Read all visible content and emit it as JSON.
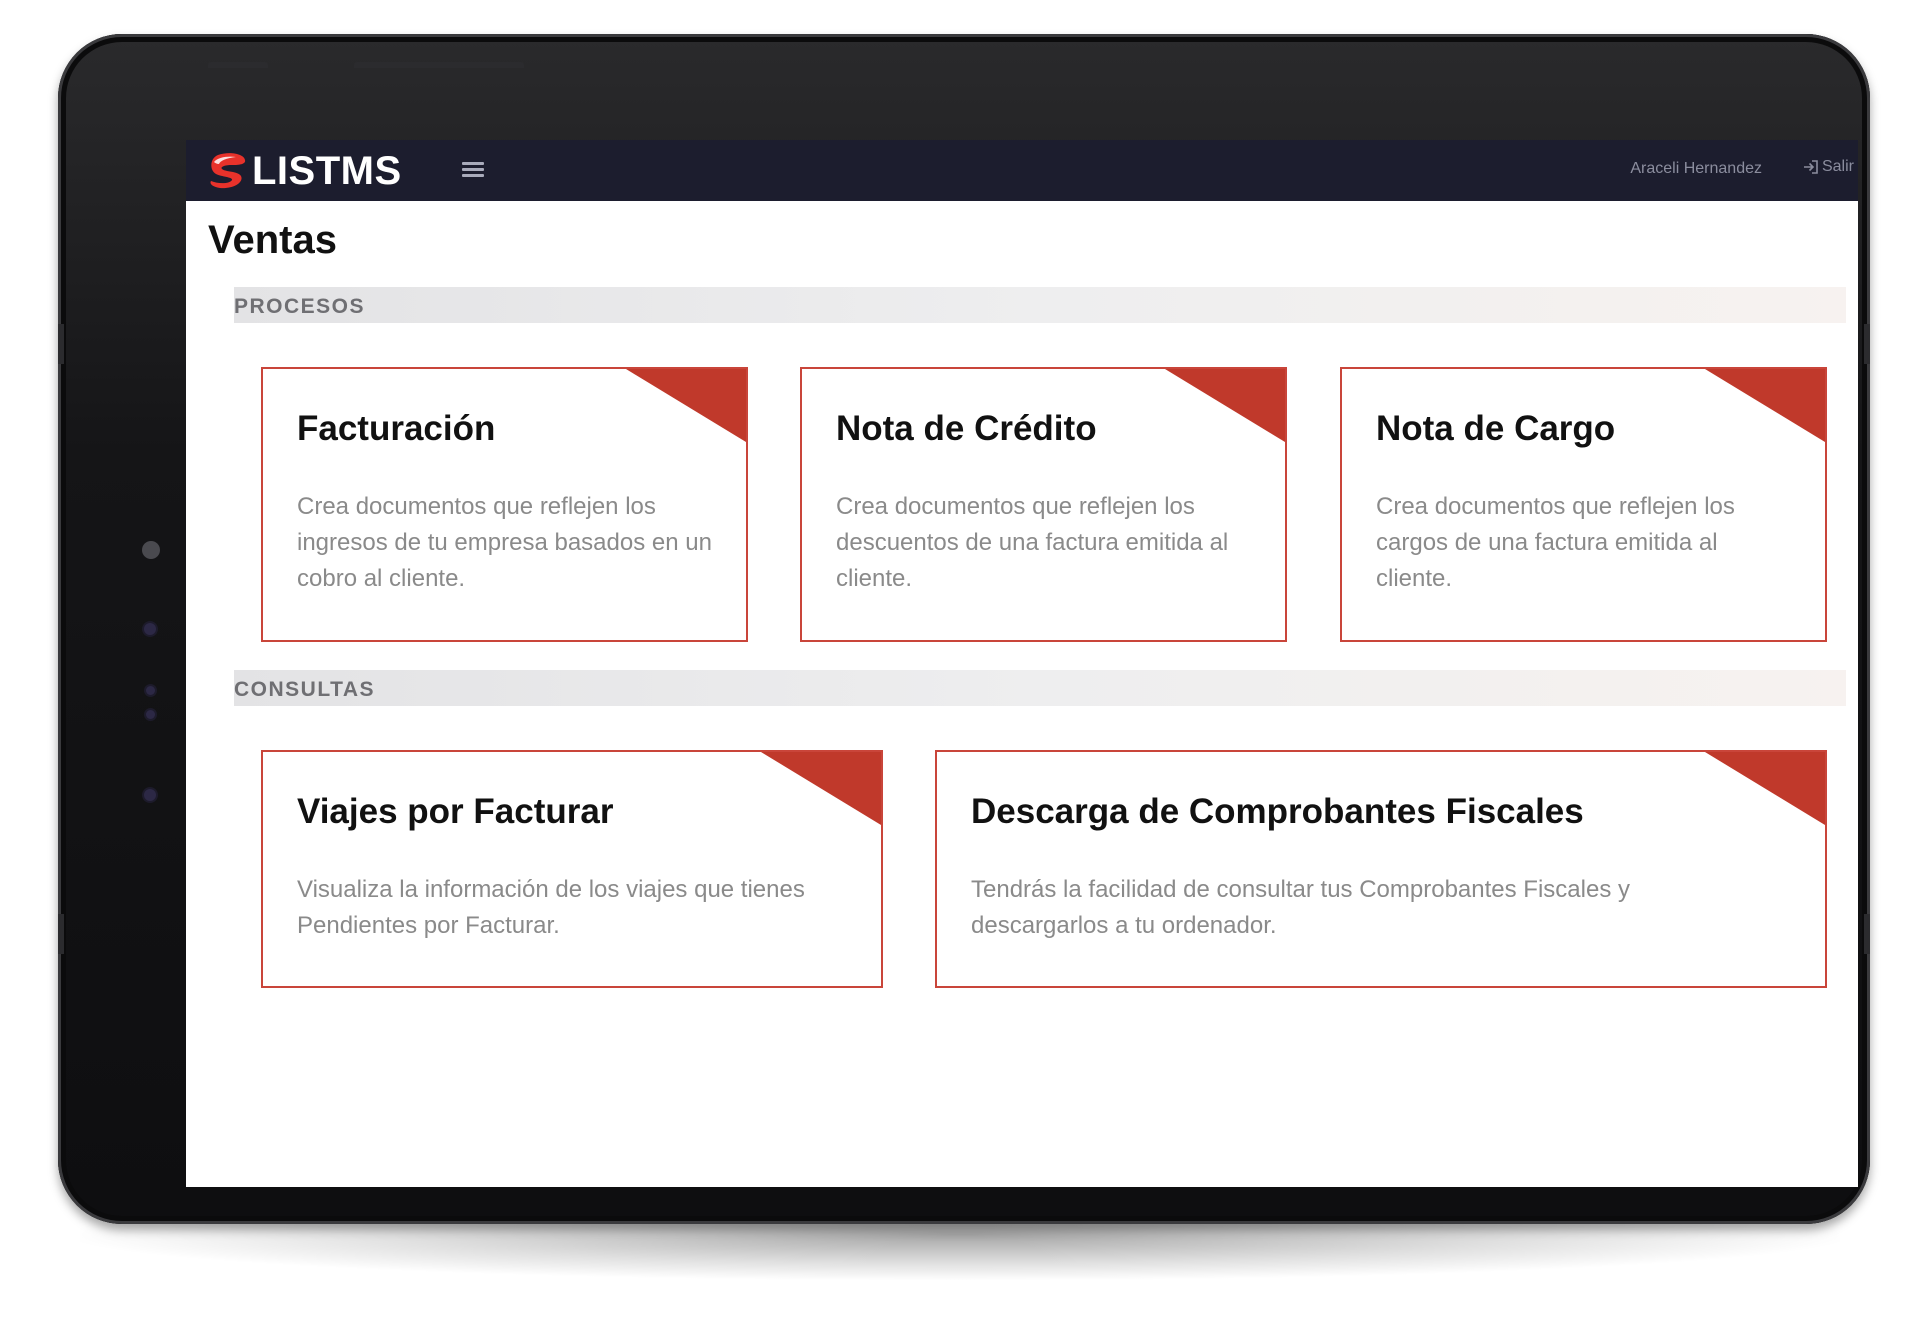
{
  "brand": {
    "logo_text": "LISTMS",
    "accent_color": "#c0392b",
    "navbar_color": "#1c1d2e"
  },
  "header": {
    "menu_icon": "hamburger-icon",
    "user_name": "Araceli Hernandez",
    "logout_icon": "logout-icon",
    "logout_label": "Salir"
  },
  "page": {
    "title": "Ventas"
  },
  "sections": {
    "procesos": {
      "label": "PROCESOS",
      "cards": [
        {
          "title": "Facturación",
          "description": "Crea documentos que reflejen los ingresos de tu empresa basados en un cobro al cliente."
        },
        {
          "title": "Nota de Crédito",
          "description": "Crea documentos que reflejen los descuentos de una factura emitida al cliente."
        },
        {
          "title": "Nota de Cargo",
          "description": "Crea documentos que reflejen los cargos de una factura emitida al cliente."
        }
      ]
    },
    "consultas": {
      "label": "CONSULTAS",
      "cards": [
        {
          "title": "Viajes por Facturar",
          "description": "Visualiza la información de los viajes que tienes Pendientes por Facturar."
        },
        {
          "title": "Descarga de Comprobantes Fiscales",
          "description": "Tendrás la facilidad de consultar tus Comprobantes Fiscales y descargarlos a tu ordenador."
        }
      ]
    }
  }
}
